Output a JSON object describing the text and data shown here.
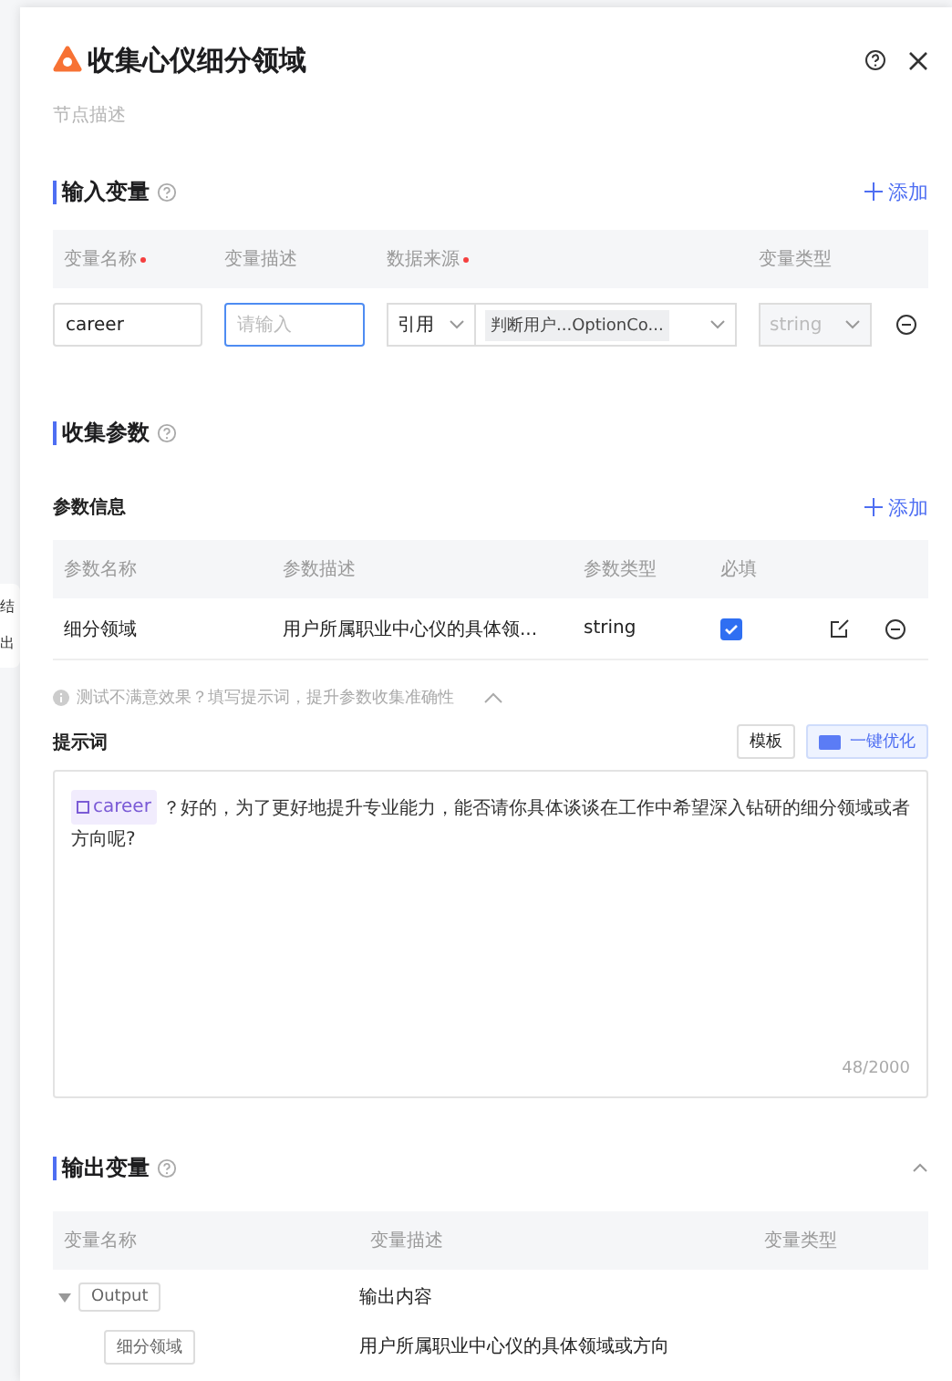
{
  "canvas_fragments": [
    "结",
    "出"
  ],
  "panel": {
    "title": "收集心仪细分领域",
    "description_placeholder": "节点描述"
  },
  "input_section": {
    "title": "输入变量",
    "add_label": "添加",
    "columns": [
      {
        "label": "变量名称",
        "required": true
      },
      {
        "label": "变量描述",
        "required": false
      },
      {
        "label": "数据来源",
        "required": true
      },
      {
        "label": "变量类型",
        "required": false
      }
    ],
    "rows": [
      {
        "name": "career",
        "description_placeholder": "请输入",
        "source_mode": "引用",
        "source_value": "判断用户...OptionCo...",
        "type": "string"
      }
    ]
  },
  "collect_section": {
    "title": "收集参数",
    "subtitle": "参数信息",
    "add_label": "添加",
    "columns": [
      "参数名称",
      "参数描述",
      "参数类型",
      "必填"
    ],
    "rows": [
      {
        "name": "细分领域",
        "description": "用户所属职业中心仪的具体领...",
        "type": "string",
        "required": true
      }
    ],
    "hint": "测试不满意效果？填写提示词，提升参数收集准确性",
    "hint_expanded": true
  },
  "prompt": {
    "label": "提示词",
    "template_button": "模板",
    "optimize_button": "一键优化",
    "variable": "career",
    "text": "？好的，为了更好地提升专业能力，能否请你具体谈谈在工作中希望深入钻研的细分领域或者方向呢?",
    "counter": "48/2000"
  },
  "output_section": {
    "title": "输出变量",
    "expanded": true,
    "columns": [
      "变量名称",
      "变量描述",
      "变量类型"
    ],
    "tree": [
      {
        "name": "Output",
        "description": "输出内容",
        "expanded": true,
        "children": [
          {
            "name": "细分领域",
            "description": "用户所属职业中心仪的具体领域或方向"
          }
        ]
      }
    ]
  }
}
